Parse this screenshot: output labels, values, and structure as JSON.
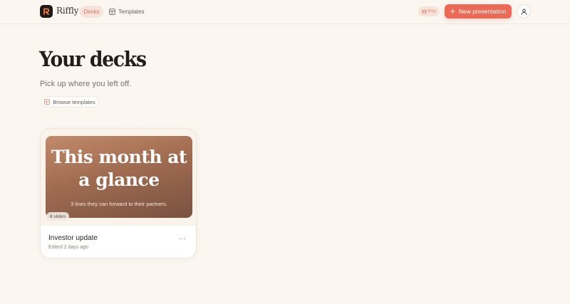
{
  "app": {
    "name": "Riffly"
  },
  "nav": {
    "tabs": [
      {
        "label": "Decks",
        "active": true
      },
      {
        "label": "Templates",
        "icon": "template-icon"
      }
    ]
  },
  "header": {
    "pro_badge": "Pro",
    "new_button": "New presentation",
    "avatar_icon": "user-icon"
  },
  "main": {
    "title": "Your decks",
    "subtitle": "Pick up where you left off.",
    "browse_button": "Browse templates"
  },
  "decks": [
    {
      "name": "Investor update",
      "edited": "Edited 2 days ago",
      "slides": "8 slides",
      "thumbnail_title": "This month at a glance",
      "thumbnail_subtitle": "3 lines they can forward to their partners.",
      "more_label": "···"
    }
  ],
  "colors": {
    "accent": "#ea6a55",
    "background": "#fbf6f0",
    "active_tab_bg": "#f8e3dc"
  }
}
